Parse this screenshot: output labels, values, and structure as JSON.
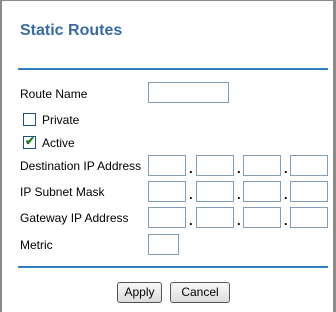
{
  "page": {
    "title": "Static Routes"
  },
  "form": {
    "route_name": {
      "label": "Route Name",
      "value": ""
    },
    "private": {
      "label": "Private",
      "checked": false
    },
    "active": {
      "label": "Active",
      "checked": true,
      "check_glyph": "✔"
    },
    "destination_ip": {
      "label": "Destination IP Address",
      "octets": [
        "",
        "",
        "",
        ""
      ]
    },
    "subnet_mask": {
      "label": "IP Subnet Mask",
      "octets": [
        "",
        "",
        "",
        ""
      ]
    },
    "gateway_ip": {
      "label": "Gateway IP Address",
      "octets": [
        "",
        "",
        "",
        ""
      ]
    },
    "metric": {
      "label": "Metric",
      "value": ""
    },
    "separator": "."
  },
  "buttons": {
    "apply": "Apply",
    "cancel": "Cancel"
  },
  "colors": {
    "title": "#3a6aa6",
    "rule": "#2f7fc3",
    "input_border": "#7f9db9",
    "frame": "#8a8a8a"
  }
}
